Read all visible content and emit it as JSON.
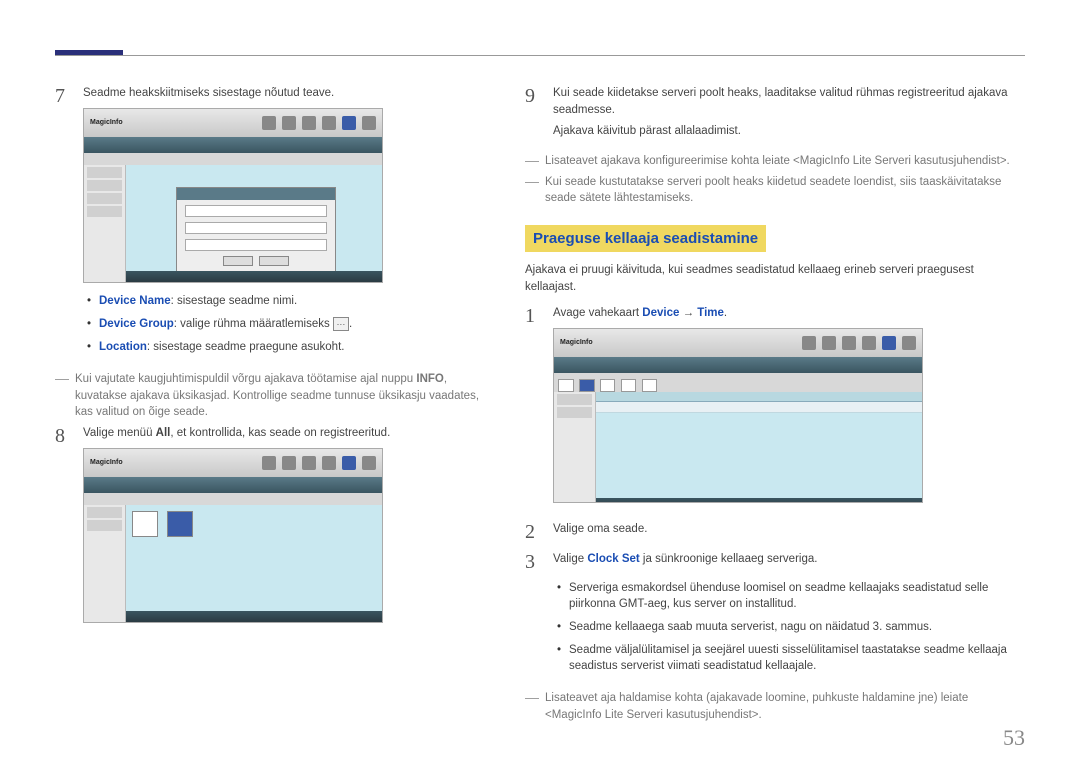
{
  "page_number": "53",
  "left": {
    "step7": {
      "num": "7",
      "text": "Seadme heakskiitmiseks sisestage nõutud teave.",
      "bullets": [
        {
          "label": "Device Name",
          "text": ": sisestage seadme nimi."
        },
        {
          "label": "Device Group",
          "text": ": valige rühma määratlemiseks "
        },
        {
          "label": "Location",
          "text": ": sisestage seadme praegune asukoht."
        }
      ],
      "note": "Kui vajutate kaugjuhtimispuldil võrgu ajakava töötamise ajal nuppu INFO, kuvatakse ajakava üksikasjad. Kontrollige seadme tunnuse üksikasju vaadates, kas valitud on õige seade.",
      "note_bold": "INFO"
    },
    "step8": {
      "num": "8",
      "text_pre": "Valige menüü ",
      "text_bold": "All",
      "text_post": ", et kontrollida, kas seade on registreeritud."
    }
  },
  "right": {
    "step9": {
      "num": "9",
      "text1": "Kui seade kiidetakse serveri poolt heaks, laaditakse valitud rühmas registreeritud ajakava seadmesse.",
      "text2": "Ajakava käivitub pärast allalaadimist."
    },
    "notes9": [
      "Lisateavet ajakava konfigureerimise kohta leiate <MagicInfo Lite Serveri kasutusjuhendist>.",
      "Kui seade kustutatakse serveri poolt heaks kiidetud seadete loendist, siis taaskäivitatakse seade sätete lähtestamiseks."
    ],
    "heading": "Praeguse kellaaja seadistamine",
    "intro": "Ajakava ei pruugi käivituda, kui seadmes seadistatud kellaaeg erineb serveri praegusest kellaajast.",
    "step1": {
      "num": "1",
      "text_pre": "Avage vahekaart ",
      "label1": "Device",
      "arrow": " → ",
      "label2": "Time",
      "text_post": "."
    },
    "step2": {
      "num": "2",
      "text": "Valige oma seade."
    },
    "step3": {
      "num": "3",
      "text_pre": "Valige ",
      "label": "Clock Set",
      "text_post": " ja sünkroonige kellaaeg serveriga."
    },
    "sub_bullets": [
      "Serveriga esmakordsel ühenduse loomisel on seadme kellaajaks seadistatud selle piirkonna GMT-aeg, kus server on installitud.",
      "Seadme kellaaega saab muuta serverist, nagu on näidatud 3. sammus.",
      "Seadme väljalülitamisel ja seejärel uuesti sisselülitamisel taastatakse seadme kellaaja seadistus serverist viimati seadistatud kellaajale."
    ],
    "end_note": "Lisateavet aja haldamise kohta (ajakavade loomine, puhkuste haldamine jne) leiate <MagicInfo Lite Serveri kasutusjuhendist>."
  },
  "icons": {
    "ellipsis": "···"
  },
  "app": {
    "logo": "MagicInfo"
  }
}
